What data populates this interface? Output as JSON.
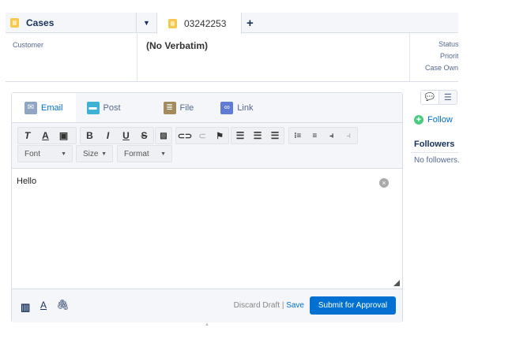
{
  "tabs": {
    "cases_label": "Cases",
    "case_number": "03242253",
    "add_icon": "plus-icon",
    "dropdown_icon": "caret-down-icon"
  },
  "header": {
    "customer_label": "Customer",
    "verbatim": "(No Verbatim)",
    "status_label": "Status",
    "priority_label": "Priority",
    "owner_label": "Case Owner"
  },
  "publisher": {
    "tabs": [
      {
        "label": "Email",
        "icon": "email-icon",
        "color": "#8ea5c4"
      },
      {
        "label": "Post",
        "icon": "post-icon",
        "color": "#3fb1d4"
      },
      {
        "label": "File",
        "icon": "file-icon",
        "color": "#a58a5c"
      },
      {
        "label": "Link",
        "icon": "link-icon",
        "color": "#5f7bd3"
      }
    ],
    "font_select": "Font",
    "size_select": "Size",
    "format_select": "Format",
    "body": "Hello",
    "discard_label": "Discard Draft",
    "separator": "|",
    "save_label": "Save",
    "submit_label": "Submit for Approval"
  },
  "sidebar": {
    "follow_label": "Follow",
    "followers_title": "Followers",
    "no_followers": "No followers."
  },
  "colors": {
    "accent": "#0070d2",
    "follow_green": "#4bca81"
  }
}
